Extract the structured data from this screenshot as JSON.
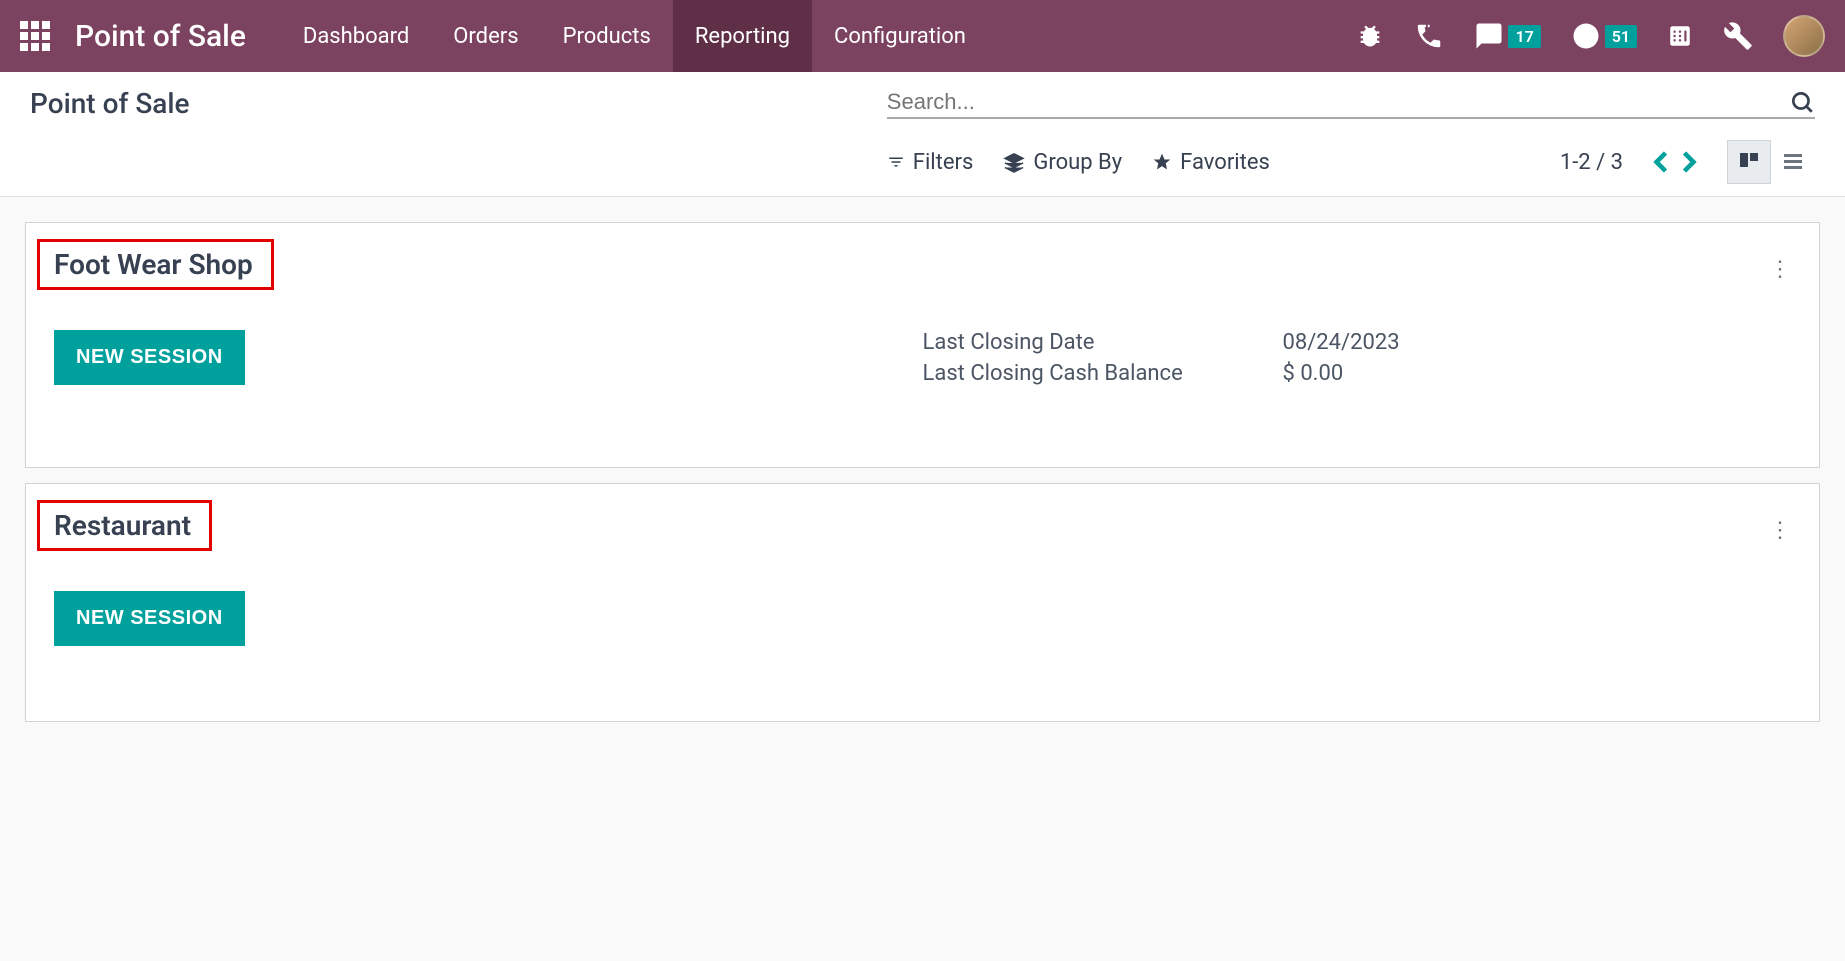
{
  "brand": "Point of Sale",
  "nav": {
    "dashboard": "Dashboard",
    "orders": "Orders",
    "products": "Products",
    "reporting": "Reporting",
    "configuration": "Configuration"
  },
  "systray": {
    "messages_count": "17",
    "activities_count": "51"
  },
  "breadcrumb": "Point of Sale",
  "search": {
    "placeholder": "Search..."
  },
  "filters": {
    "filters_label": "Filters",
    "groupby_label": "Group By",
    "favorites_label": "Favorites"
  },
  "pager": "1-2 / 3",
  "cards": [
    {
      "title": "Foot Wear Shop",
      "button": "NEW SESSION",
      "info": [
        {
          "label": "Last Closing Date",
          "value": "08/24/2023"
        },
        {
          "label": "Last Closing Cash Balance",
          "value": "$ 0.00"
        }
      ]
    },
    {
      "title": "Restaurant",
      "button": "NEW SESSION",
      "info": []
    }
  ]
}
